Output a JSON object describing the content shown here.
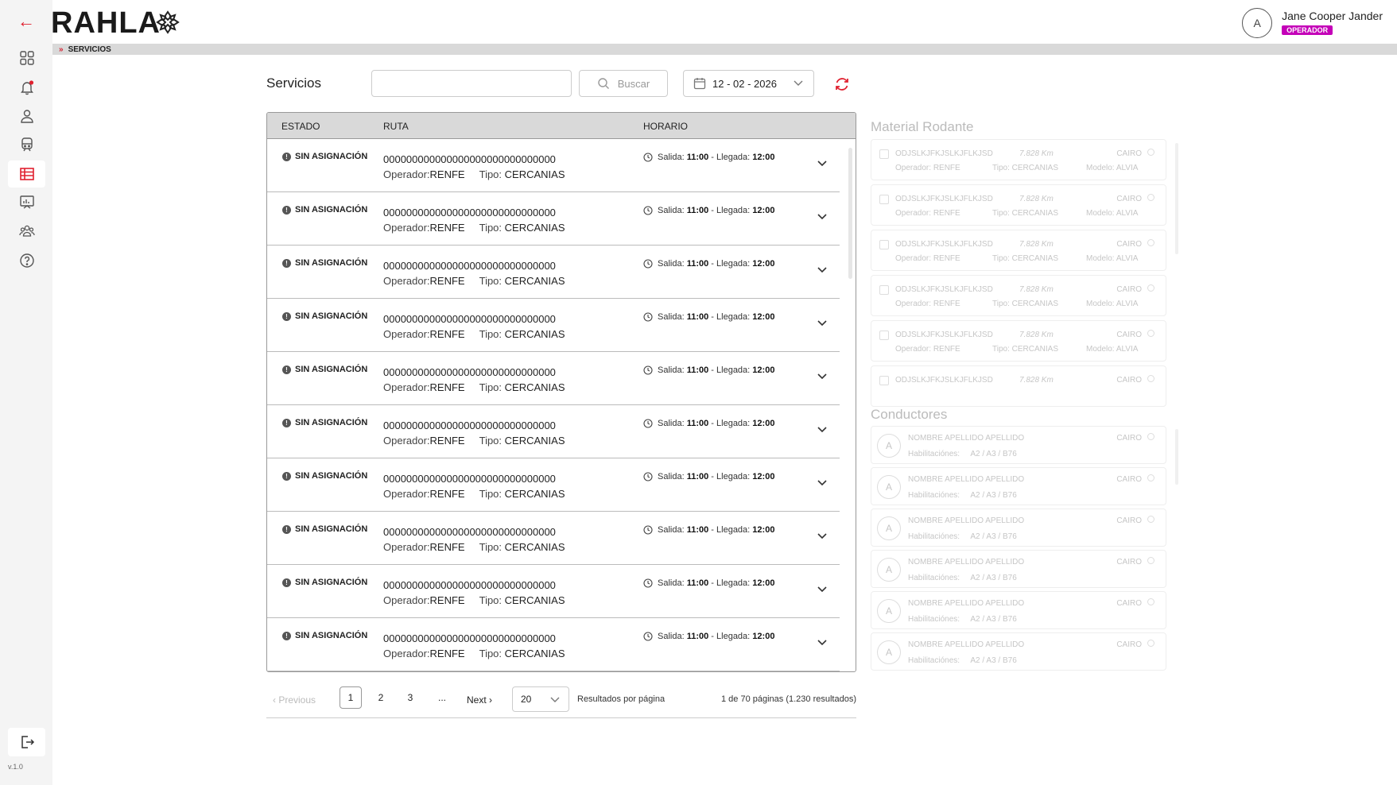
{
  "brand": {
    "name": "RAHLA"
  },
  "user": {
    "avatar_initial": "A",
    "name": "Jane Cooper Jander",
    "role": "OPERADOR"
  },
  "breadcrumb": {
    "label": "SERVICIOS"
  },
  "sidebar": {
    "items": [
      {
        "name": "dashboard-icon"
      },
      {
        "name": "notifications-icon"
      },
      {
        "name": "user-icon"
      },
      {
        "name": "train-icon"
      },
      {
        "name": "services-table-icon",
        "active": true
      },
      {
        "name": "reports-board-icon"
      },
      {
        "name": "team-icon"
      },
      {
        "name": "help-icon"
      }
    ],
    "version": "v.1.0"
  },
  "toolbar": {
    "title": "Servicios",
    "search_value": "",
    "search_button": "Buscar",
    "date": "12 - 02 - 2026"
  },
  "table": {
    "headers": {
      "estado": "ESTADO",
      "ruta": "RUTA",
      "horario": "HORARIO"
    },
    "rows": [
      {
        "status": "SIN ASIGNACIÓN",
        "route_id": "000000000000000000000000000000",
        "operator_label": "Operador:",
        "operator": "RENFE",
        "type_label": "Tipo:",
        "type": "CERCANIAS",
        "dep_label": "Salida:",
        "dep": "11:00",
        "sep": "- Llegada:",
        "arr": "12:00"
      },
      {
        "status": "SIN ASIGNACIÓN",
        "route_id": "000000000000000000000000000000",
        "operator_label": "Operador:",
        "operator": "RENFE",
        "type_label": "Tipo:",
        "type": "CERCANIAS",
        "dep_label": "Salida:",
        "dep": "11:00",
        "sep": "- Llegada:",
        "arr": "12:00"
      },
      {
        "status": "SIN ASIGNACIÓN",
        "route_id": "000000000000000000000000000000",
        "operator_label": "Operador:",
        "operator": "RENFE",
        "type_label": "Tipo:",
        "type": "CERCANIAS",
        "dep_label": "Salida:",
        "dep": "11:00",
        "sep": "- Llegada:",
        "arr": "12:00"
      },
      {
        "status": "SIN ASIGNACIÓN",
        "route_id": "000000000000000000000000000000",
        "operator_label": "Operador:",
        "operator": "RENFE",
        "type_label": "Tipo:",
        "type": "CERCANIAS",
        "dep_label": "Salida:",
        "dep": "11:00",
        "sep": "- Llegada:",
        "arr": "12:00"
      },
      {
        "status": "SIN ASIGNACIÓN",
        "route_id": "000000000000000000000000000000",
        "operator_label": "Operador:",
        "operator": "RENFE",
        "type_label": "Tipo:",
        "type": "CERCANIAS",
        "dep_label": "Salida:",
        "dep": "11:00",
        "sep": "- Llegada:",
        "arr": "12:00"
      },
      {
        "status": "SIN ASIGNACIÓN",
        "route_id": "000000000000000000000000000000",
        "operator_label": "Operador:",
        "operator": "RENFE",
        "type_label": "Tipo:",
        "type": "CERCANIAS",
        "dep_label": "Salida:",
        "dep": "11:00",
        "sep": "- Llegada:",
        "arr": "12:00"
      },
      {
        "status": "SIN ASIGNACIÓN",
        "route_id": "000000000000000000000000000000",
        "operator_label": "Operador:",
        "operator": "RENFE",
        "type_label": "Tipo:",
        "type": "CERCANIAS",
        "dep_label": "Salida:",
        "dep": "11:00",
        "sep": "- Llegada:",
        "arr": "12:00"
      },
      {
        "status": "SIN ASIGNACIÓN",
        "route_id": "000000000000000000000000000000",
        "operator_label": "Operador:",
        "operator": "RENFE",
        "type_label": "Tipo:",
        "type": "CERCANIAS",
        "dep_label": "Salida:",
        "dep": "11:00",
        "sep": "- Llegada:",
        "arr": "12:00"
      },
      {
        "status": "SIN ASIGNACIÓN",
        "route_id": "000000000000000000000000000000",
        "operator_label": "Operador:",
        "operator": "RENFE",
        "type_label": "Tipo:",
        "type": "CERCANIAS",
        "dep_label": "Salida:",
        "dep": "11:00",
        "sep": "- Llegada:",
        "arr": "12:00"
      },
      {
        "status": "SIN ASIGNACIÓN",
        "route_id": "000000000000000000000000000000",
        "operator_label": "Operador:",
        "operator": "RENFE",
        "type_label": "Tipo:",
        "type": "CERCANIAS",
        "dep_label": "Salida:",
        "dep": "11:00",
        "sep": "- Llegada:",
        "arr": "12:00"
      }
    ]
  },
  "pagination": {
    "previous": "Previous",
    "pages": [
      "1",
      "2",
      "3",
      "..."
    ],
    "current": "1",
    "next": "Next",
    "per_page": "20",
    "per_page_label": "Resultados por página",
    "summary": "1 de 70 páginas (1.230 resultados)"
  },
  "material_rodante": {
    "title": "Material Rodante",
    "items": [
      {
        "code": "ODJSLKJFKJSLKJFLKJSD",
        "km": "7.828 Km",
        "city": "CAIRO",
        "operator_label": "Operador:",
        "operator": "RENFE",
        "type_label": "Tipo:",
        "type": "CERCANIAS",
        "model_label": "Modelo:",
        "model": "ALVIA"
      },
      {
        "code": "ODJSLKJFKJSLKJFLKJSD",
        "km": "7.828 Km",
        "city": "CAIRO",
        "operator_label": "Operador:",
        "operator": "RENFE",
        "type_label": "Tipo:",
        "type": "CERCANIAS",
        "model_label": "Modelo:",
        "model": "ALVIA"
      },
      {
        "code": "ODJSLKJFKJSLKJFLKJSD",
        "km": "7.828 Km",
        "city": "CAIRO",
        "operator_label": "Operador:",
        "operator": "RENFE",
        "type_label": "Tipo:",
        "type": "CERCANIAS",
        "model_label": "Modelo:",
        "model": "ALVIA"
      },
      {
        "code": "ODJSLKJFKJSLKJFLKJSD",
        "km": "7.828 Km",
        "city": "CAIRO",
        "operator_label": "Operador:",
        "operator": "RENFE",
        "type_label": "Tipo:",
        "type": "CERCANIAS",
        "model_label": "Modelo:",
        "model": "ALVIA"
      },
      {
        "code": "ODJSLKJFKJSLKJFLKJSD",
        "km": "7.828 Km",
        "city": "CAIRO",
        "operator_label": "Operador:",
        "operator": "RENFE",
        "type_label": "Tipo:",
        "type": "CERCANIAS",
        "model_label": "Modelo:",
        "model": "ALVIA"
      },
      {
        "code": "ODJSLKJFKJSLKJFLKJSD",
        "km": "7.828 Km",
        "city": "CAIRO",
        "operator_label": "",
        "operator": "",
        "type_label": "",
        "type": "",
        "model_label": "",
        "model": ""
      }
    ]
  },
  "conductores": {
    "title": "Conductores",
    "items": [
      {
        "initial": "A",
        "name": "NOMBRE APELLIDO APELLIDO",
        "city": "CAIRO",
        "hab_label": "Habilitaciónes:",
        "hab": "A2 / A3 / B76"
      },
      {
        "initial": "A",
        "name": "NOMBRE APELLIDO APELLIDO",
        "city": "CAIRO",
        "hab_label": "Habilitaciónes:",
        "hab": "A2 / A3 / B76"
      },
      {
        "initial": "A",
        "name": "NOMBRE APELLIDO APELLIDO",
        "city": "CAIRO",
        "hab_label": "Habilitaciónes:",
        "hab": "A2 / A3 / B76"
      },
      {
        "initial": "A",
        "name": "NOMBRE APELLIDO APELLIDO",
        "city": "CAIRO",
        "hab_label": "Habilitaciónes:",
        "hab": "A2 / A3 / B76"
      },
      {
        "initial": "A",
        "name": "NOMBRE APELLIDO APELLIDO",
        "city": "CAIRO",
        "hab_label": "Habilitaciónes:",
        "hab": "A2 / A3 / B76"
      },
      {
        "initial": "A",
        "name": "NOMBRE APELLIDO APELLIDO",
        "city": "CAIRO",
        "hab_label": "Habilitaciónes:",
        "hab": "A2 / A3 / B76"
      }
    ]
  },
  "colors": {
    "accent": "#e0202f",
    "role_badge": "#c400b8",
    "header_bg": "#d9d9d9",
    "sidebar_bg": "#f4f4f4"
  }
}
